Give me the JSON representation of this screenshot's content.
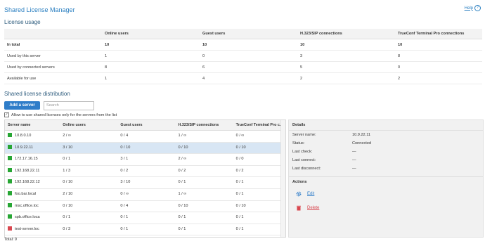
{
  "app": {
    "title": "Shared License Manager",
    "help": "Help"
  },
  "usage": {
    "heading": "License usage",
    "columns": [
      "",
      "Online users",
      "Guest users",
      "H.323/SIP connections",
      "TrueConf Terminal Pro connections"
    ],
    "rows": [
      {
        "label": "In total",
        "values": [
          "10",
          "10",
          "10",
          "10"
        ]
      },
      {
        "label": "Used by this server",
        "values": [
          "1",
          "0",
          "3",
          "8"
        ]
      },
      {
        "label": "Used by connected servers",
        "values": [
          "8",
          "6",
          "5",
          "0"
        ]
      },
      {
        "label": "Available for use",
        "values": [
          "1",
          "4",
          "2",
          "2"
        ]
      }
    ]
  },
  "distribution": {
    "heading": "Shared license distribution",
    "add_button": "Add a server",
    "search_placeholder": "Search",
    "checkbox_label": "Allow to use shared licenses only for the servers from the list",
    "columns": [
      "Server name",
      "Online users",
      "Guest users",
      "H.323/SIP connections",
      "TrueConf Terminal Pro c..."
    ],
    "rows": [
      {
        "name": "10.8.0.10",
        "status": "green",
        "online": "2 / ∞",
        "guest": "0 / 4",
        "h323": "1 / ∞",
        "terminal": "0 / ∞"
      },
      {
        "name": "10.9.22.11",
        "status": "green",
        "online": "3 / 10",
        "guest": "0 / 10",
        "h323": "0 / 10",
        "terminal": "0 / 10"
      },
      {
        "name": "172.17.16.15",
        "status": "green",
        "online": "0 / 1",
        "guest": "3 / 1",
        "h323": "2 / ∞",
        "terminal": "0 / 0"
      },
      {
        "name": "192.168.22.11",
        "status": "green",
        "online": "1 / 3",
        "guest": "0 / 2",
        "h323": "0 / 2",
        "terminal": "0 / 2"
      },
      {
        "name": "192.168.22.12",
        "status": "green",
        "online": "0 / 10",
        "guest": "3 / 10",
        "h323": "0 / 1",
        "terminal": "0 / 1"
      },
      {
        "name": "foo.bar.local",
        "status": "green",
        "online": "2 / 10",
        "guest": "0 / ∞",
        "h323": "1 / ∞",
        "terminal": "0 / 1"
      },
      {
        "name": "msc.office.loc",
        "status": "green",
        "online": "0 / 10",
        "guest": "0 / 4",
        "h323": "0 / 10",
        "terminal": "0 / 10"
      },
      {
        "name": "spb.office.loca",
        "status": "green",
        "online": "0 / 1",
        "guest": "0 / 1",
        "h323": "0 / 1",
        "terminal": "0 / 1"
      },
      {
        "name": "test-server.loc",
        "status": "red",
        "online": "0 / 3",
        "guest": "0 / 1",
        "h323": "0 / 1",
        "terminal": "0 / 1"
      }
    ],
    "total": "Total: 9"
  },
  "details": {
    "heading": "Details",
    "fields": [
      {
        "label": "Server name:",
        "value": "10.9.22.11"
      },
      {
        "label": "Status:",
        "value": "Connected"
      },
      {
        "label": "Last check:",
        "value": "—"
      },
      {
        "label": "Last connect:",
        "value": "—"
      },
      {
        "label": "Last disconnect:",
        "value": "—"
      }
    ],
    "actions_heading": "Actions",
    "edit": "Edit",
    "delete": "Delete"
  },
  "colors": {
    "accent": "#2f7dc9",
    "online": "#27a634",
    "offline": "#d9474f",
    "delete": "#d9474f"
  },
  "icons": {
    "help": "question-circle-icon",
    "edit": "gear-icon",
    "delete": "trash-icon",
    "status": "status-square-icon",
    "checkbox": "checkbox-checked-icon"
  }
}
